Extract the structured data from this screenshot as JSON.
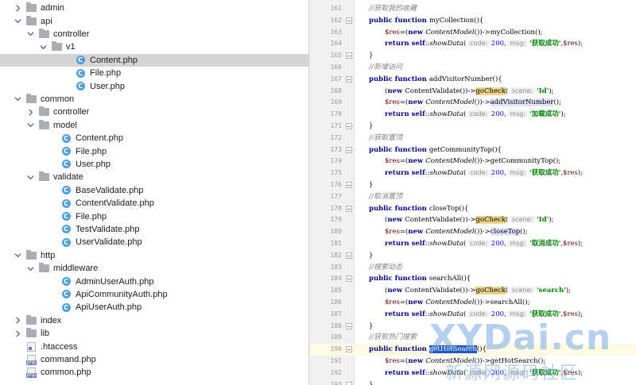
{
  "tree": [
    {
      "label": "admin",
      "type": "folder",
      "depth": 1,
      "expanded": false
    },
    {
      "label": "api",
      "type": "folder",
      "depth": 1,
      "expanded": true
    },
    {
      "label": "controller",
      "type": "folder",
      "depth": 2,
      "expanded": true
    },
    {
      "label": "v1",
      "type": "folder",
      "depth": 3,
      "expanded": true
    },
    {
      "label": "Content.php",
      "type": "php",
      "depth": 5,
      "selected": true
    },
    {
      "label": "File.php",
      "type": "php",
      "depth": 5
    },
    {
      "label": "User.php",
      "type": "php",
      "depth": 5
    },
    {
      "label": "common",
      "type": "folder",
      "depth": 1,
      "expanded": true
    },
    {
      "label": "controller",
      "type": "folder",
      "depth": 2,
      "expanded": false
    },
    {
      "label": "model",
      "type": "folder",
      "depth": 2,
      "expanded": true
    },
    {
      "label": "Content.php",
      "type": "php",
      "depth": 4
    },
    {
      "label": "File.php",
      "type": "php",
      "depth": 4
    },
    {
      "label": "User.php",
      "type": "php",
      "depth": 4
    },
    {
      "label": "validate",
      "type": "folder",
      "depth": 2,
      "expanded": true
    },
    {
      "label": "BaseValidate.php",
      "type": "php",
      "depth": 4
    },
    {
      "label": "ContentValidate.php",
      "type": "php",
      "depth": 4
    },
    {
      "label": "File.php",
      "type": "php",
      "depth": 4
    },
    {
      "label": "TestValidate.php",
      "type": "php",
      "depth": 4
    },
    {
      "label": "UserValidate.php",
      "type": "php",
      "depth": 4
    },
    {
      "label": "http",
      "type": "folder",
      "depth": 1,
      "expanded": true
    },
    {
      "label": "middleware",
      "type": "folder",
      "depth": 2,
      "expanded": true
    },
    {
      "label": "AdminUserAuth.php",
      "type": "php",
      "depth": 4
    },
    {
      "label": "ApiCommunityAuth.php",
      "type": "php",
      "depth": 4
    },
    {
      "label": "ApiUserAuth.php",
      "type": "php",
      "depth": 4
    },
    {
      "label": "index",
      "type": "folder",
      "depth": 1,
      "expanded": false
    },
    {
      "label": "lib",
      "type": "folder",
      "depth": 1,
      "expanded": false
    },
    {
      "label": ".htaccess",
      "type": "dotfile",
      "depth": 1
    },
    {
      "label": "command.php",
      "type": "phpfile",
      "depth": 1
    },
    {
      "label": "common.php",
      "type": "phpfile",
      "depth": 1
    }
  ],
  "editor": {
    "current_line": 190,
    "lines": [
      {
        "n": 161,
        "indent": 1,
        "tokens": [
          {
            "t": "//获取我的收藏",
            "c": "cmt"
          }
        ]
      },
      {
        "n": 162,
        "indent": 1,
        "fold": true,
        "tokens": [
          {
            "t": "public function ",
            "c": "kw"
          },
          {
            "t": "myCollection(){",
            "c": ""
          }
        ]
      },
      {
        "n": 163,
        "indent": 2,
        "tokens": [
          {
            "t": "$res",
            "c": "var"
          },
          {
            "t": "=(",
            "c": ""
          },
          {
            "t": "new ",
            "c": "kw"
          },
          {
            "t": "ContentModel",
            "c": "cls"
          },
          {
            "t": "())->myCollection();",
            "c": ""
          }
        ]
      },
      {
        "n": 164,
        "indent": 2,
        "tokens": [
          {
            "t": "return self",
            "c": "kw"
          },
          {
            "t": "::",
            "c": ""
          },
          {
            "t": "showData",
            "c": "static"
          },
          {
            "t": "( ",
            "c": ""
          },
          {
            "t": "code:",
            "c": "hint"
          },
          {
            "t": " 200",
            "c": "num"
          },
          {
            "t": ",  ",
            "c": ""
          },
          {
            "t": "msg:",
            "c": "hint"
          },
          {
            "t": " '获取成功'",
            "c": "str"
          },
          {
            "t": ",",
            "c": ""
          },
          {
            "t": "$res",
            "c": "var"
          },
          {
            "t": ");",
            "c": ""
          }
        ]
      },
      {
        "n": 165,
        "indent": 1,
        "fold": true,
        "tokens": [
          {
            "t": "}",
            "c": ""
          }
        ]
      },
      {
        "n": 166,
        "indent": 1,
        "tokens": [
          {
            "t": "//新增访问",
            "c": "cmt"
          }
        ]
      },
      {
        "n": 167,
        "indent": 1,
        "fold": true,
        "tokens": [
          {
            "t": "public function ",
            "c": "kw"
          },
          {
            "t": "addVisitorNumber(){",
            "c": ""
          }
        ]
      },
      {
        "n": 168,
        "indent": 2,
        "tokens": [
          {
            "t": "(",
            "c": ""
          },
          {
            "t": "new ",
            "c": "kw"
          },
          {
            "t": "ContentValidate",
            "c": ""
          },
          {
            "t": "())->",
            "c": ""
          },
          {
            "t": "goCheck",
            "c": "mcall-hl"
          },
          {
            "t": "( ",
            "c": ""
          },
          {
            "t": "scene:",
            "c": "hint"
          },
          {
            "t": " 'Id'",
            "c": "str"
          },
          {
            "t": ");",
            "c": ""
          }
        ]
      },
      {
        "n": 169,
        "indent": 2,
        "tokens": [
          {
            "t": "$res",
            "c": "var"
          },
          {
            "t": "=(",
            "c": ""
          },
          {
            "t": "new ",
            "c": "kw"
          },
          {
            "t": "ContentModel",
            "c": "cls"
          },
          {
            "t": "())->",
            "c": ""
          },
          {
            "t": "addVisitorNumber",
            "c": "mcall-hl2"
          },
          {
            "t": "();",
            "c": ""
          }
        ]
      },
      {
        "n": 170,
        "indent": 2,
        "tokens": [
          {
            "t": "return self",
            "c": "kw"
          },
          {
            "t": "::",
            "c": ""
          },
          {
            "t": "showData",
            "c": "static"
          },
          {
            "t": "( ",
            "c": ""
          },
          {
            "t": "code:",
            "c": "hint"
          },
          {
            "t": " 200",
            "c": "num"
          },
          {
            "t": ",  ",
            "c": ""
          },
          {
            "t": "msg:",
            "c": "hint"
          },
          {
            "t": " '加载成功'",
            "c": "str"
          },
          {
            "t": ");",
            "c": ""
          }
        ]
      },
      {
        "n": 171,
        "indent": 1,
        "fold": true,
        "tokens": [
          {
            "t": "}",
            "c": ""
          }
        ]
      },
      {
        "n": 172,
        "indent": 1,
        "tokens": [
          {
            "t": "//获取置顶",
            "c": "cmt"
          }
        ]
      },
      {
        "n": 173,
        "indent": 1,
        "fold": true,
        "tokens": [
          {
            "t": "public function ",
            "c": "kw"
          },
          {
            "t": "getCommunityTop(){",
            "c": ""
          }
        ]
      },
      {
        "n": 174,
        "indent": 2,
        "tokens": [
          {
            "t": "$res",
            "c": "var"
          },
          {
            "t": "=(",
            "c": ""
          },
          {
            "t": "new ",
            "c": "kw"
          },
          {
            "t": "ContentModel",
            "c": "cls"
          },
          {
            "t": "())->getCommunityTop();",
            "c": ""
          }
        ]
      },
      {
        "n": 175,
        "indent": 2,
        "tokens": [
          {
            "t": "return self",
            "c": "kw"
          },
          {
            "t": "::",
            "c": ""
          },
          {
            "t": "showData",
            "c": "static"
          },
          {
            "t": "( ",
            "c": ""
          },
          {
            "t": "code:",
            "c": "hint"
          },
          {
            "t": " 200",
            "c": "num"
          },
          {
            "t": ",  ",
            "c": ""
          },
          {
            "t": "msg:",
            "c": "hint"
          },
          {
            "t": " '获取成功'",
            "c": "str"
          },
          {
            "t": ",",
            "c": ""
          },
          {
            "t": "$res",
            "c": "var"
          },
          {
            "t": ");",
            "c": ""
          }
        ]
      },
      {
        "n": 176,
        "indent": 1,
        "fold": true,
        "tokens": [
          {
            "t": "}",
            "c": ""
          }
        ]
      },
      {
        "n": 177,
        "indent": 1,
        "tokens": [
          {
            "t": "//取消置顶",
            "c": "cmt"
          }
        ]
      },
      {
        "n": 178,
        "indent": 1,
        "fold": true,
        "tokens": [
          {
            "t": "public function ",
            "c": "kw"
          },
          {
            "t": "closeTop(){",
            "c": ""
          }
        ]
      },
      {
        "n": 179,
        "indent": 2,
        "tokens": [
          {
            "t": "(",
            "c": ""
          },
          {
            "t": "new ",
            "c": "kw"
          },
          {
            "t": "ContentValidate",
            "c": ""
          },
          {
            "t": "())->",
            "c": ""
          },
          {
            "t": "goCheck",
            "c": "mcall-hl"
          },
          {
            "t": "( ",
            "c": ""
          },
          {
            "t": "scene:",
            "c": "hint"
          },
          {
            "t": " 'Id'",
            "c": "str"
          },
          {
            "t": ");",
            "c": ""
          }
        ]
      },
      {
        "n": 180,
        "indent": 2,
        "tokens": [
          {
            "t": "$res",
            "c": "var"
          },
          {
            "t": "=(",
            "c": ""
          },
          {
            "t": "new ",
            "c": "kw"
          },
          {
            "t": "ContentModel",
            "c": "cls"
          },
          {
            "t": "())->",
            "c": ""
          },
          {
            "t": "closeTop",
            "c": "mcall-hl2"
          },
          {
            "t": "();",
            "c": ""
          }
        ]
      },
      {
        "n": 181,
        "indent": 2,
        "tokens": [
          {
            "t": "return self",
            "c": "kw"
          },
          {
            "t": "::",
            "c": ""
          },
          {
            "t": "showData",
            "c": "static"
          },
          {
            "t": "( ",
            "c": ""
          },
          {
            "t": "code:",
            "c": "hint"
          },
          {
            "t": " 200",
            "c": "num"
          },
          {
            "t": ",  ",
            "c": ""
          },
          {
            "t": "msg:",
            "c": "hint"
          },
          {
            "t": " '取消成功'",
            "c": "str"
          },
          {
            "t": ",",
            "c": ""
          },
          {
            "t": "$res",
            "c": "var"
          },
          {
            "t": ");",
            "c": ""
          }
        ]
      },
      {
        "n": 182,
        "indent": 1,
        "fold": true,
        "tokens": [
          {
            "t": "}",
            "c": ""
          }
        ]
      },
      {
        "n": 183,
        "indent": 1,
        "tokens": [
          {
            "t": "//搜索动态",
            "c": "cmt"
          }
        ]
      },
      {
        "n": 184,
        "indent": 1,
        "fold": true,
        "tokens": [
          {
            "t": "public function ",
            "c": "kw"
          },
          {
            "t": "searchAll(){",
            "c": ""
          }
        ]
      },
      {
        "n": 185,
        "indent": 2,
        "tokens": [
          {
            "t": "(",
            "c": ""
          },
          {
            "t": "new ",
            "c": "kw"
          },
          {
            "t": "ContentValidate",
            "c": ""
          },
          {
            "t": "())->",
            "c": ""
          },
          {
            "t": "goCheck",
            "c": "mcall-hl"
          },
          {
            "t": "( ",
            "c": ""
          },
          {
            "t": "scene:",
            "c": "hint"
          },
          {
            "t": " 'search'",
            "c": "str"
          },
          {
            "t": ");",
            "c": ""
          }
        ]
      },
      {
        "n": 186,
        "indent": 2,
        "tokens": [
          {
            "t": "$res",
            "c": "var"
          },
          {
            "t": "=(",
            "c": ""
          },
          {
            "t": "new ",
            "c": "kw"
          },
          {
            "t": "ContentModel",
            "c": "cls"
          },
          {
            "t": "())->searchAll();",
            "c": ""
          }
        ]
      },
      {
        "n": 187,
        "indent": 2,
        "tokens": [
          {
            "t": "return self",
            "c": "kw"
          },
          {
            "t": "::",
            "c": ""
          },
          {
            "t": "showData",
            "c": "static"
          },
          {
            "t": "( ",
            "c": ""
          },
          {
            "t": "code:",
            "c": "hint"
          },
          {
            "t": " 200",
            "c": "num"
          },
          {
            "t": ",  ",
            "c": ""
          },
          {
            "t": "msg:",
            "c": "hint"
          },
          {
            "t": " '获取成功'",
            "c": "str"
          },
          {
            "t": ",",
            "c": ""
          },
          {
            "t": "$res",
            "c": "var"
          },
          {
            "t": ");",
            "c": ""
          }
        ]
      },
      {
        "n": 188,
        "indent": 1,
        "fold": true,
        "tokens": [
          {
            "t": "}",
            "c": ""
          }
        ]
      },
      {
        "n": 189,
        "indent": 1,
        "tokens": [
          {
            "t": "//获取热门搜索",
            "c": "cmt"
          }
        ]
      },
      {
        "n": 190,
        "indent": 1,
        "fold": true,
        "tokens": [
          {
            "t": "public function ",
            "c": "kw"
          },
          {
            "t": "getHotSearch",
            "c": "sel-word"
          },
          {
            "t": "(){",
            "c": ""
          }
        ]
      },
      {
        "n": 191,
        "indent": 2,
        "tokens": [
          {
            "t": "$res",
            "c": "var"
          },
          {
            "t": "=(",
            "c": ""
          },
          {
            "t": "new ",
            "c": "kw"
          },
          {
            "t": "ContentModel",
            "c": "cls"
          },
          {
            "t": "())->getHotSearch();",
            "c": ""
          }
        ]
      },
      {
        "n": 192,
        "indent": 2,
        "tokens": [
          {
            "t": "return self",
            "c": "kw"
          },
          {
            "t": "::",
            "c": ""
          },
          {
            "t": "showData",
            "c": "static"
          },
          {
            "t": "( ",
            "c": ""
          },
          {
            "t": "code:",
            "c": "hint"
          },
          {
            "t": " 200",
            "c": "num"
          },
          {
            "t": ",  ",
            "c": ""
          },
          {
            "t": "msg:",
            "c": "hint"
          },
          {
            "t": " '获取成功'",
            "c": "str"
          },
          {
            "t": ",",
            "c": ""
          },
          {
            "t": "$res",
            "c": "var"
          },
          {
            "t": ");",
            "c": ""
          }
        ]
      },
      {
        "n": 193,
        "indent": 1,
        "fold": true,
        "tokens": [
          {
            "t": "}",
            "c": ""
          }
        ]
      }
    ]
  },
  "watermark": {
    "main": "XYDai.cn",
    "sub": "新源网源码社区"
  },
  "colors": {
    "selection": "#d4d4d4",
    "current_line": "#fffae3",
    "keyword": "#000080",
    "string": "#008000",
    "comment": "#808080"
  }
}
